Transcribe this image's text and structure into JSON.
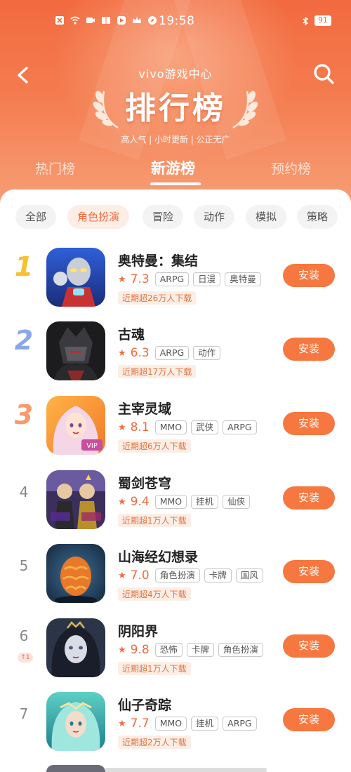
{
  "status_bar": {
    "time": "19:58",
    "battery": "91"
  },
  "header": {
    "brand": "vivo游戏中心",
    "title": "排行榜",
    "subtitle": "高人气 | 小时更新 | 公正无广"
  },
  "tabs": [
    {
      "label": "热门榜",
      "active": false
    },
    {
      "label": "新游榜",
      "active": true
    },
    {
      "label": "预约榜",
      "active": false
    }
  ],
  "filters": [
    {
      "label": "全部",
      "active": false
    },
    {
      "label": "角色扮演",
      "active": true
    },
    {
      "label": "冒险",
      "active": false
    },
    {
      "label": "动作",
      "active": false
    },
    {
      "label": "模拟",
      "active": false
    },
    {
      "label": "策略",
      "active": false
    }
  ],
  "install_label": "安装",
  "games": [
    {
      "rank": "1",
      "name": "奥特曼：集结",
      "score": "7.3",
      "tags": [
        "ARPG",
        "日漫",
        "奥特曼"
      ],
      "downloads": "近期超26万人下载",
      "icon": "ultraman-icon"
    },
    {
      "rank": "2",
      "name": "古魂",
      "score": "6.3",
      "tags": [
        "ARPG",
        "动作"
      ],
      "downloads": "近期超17万人下载",
      "icon": "dark-knight-icon"
    },
    {
      "rank": "3",
      "name": "主宰灵域",
      "score": "8.1",
      "tags": [
        "MMO",
        "武侠",
        "ARPG"
      ],
      "downloads": "近期超6万人下载",
      "icon": "fairy-girl-icon"
    },
    {
      "rank": "4",
      "name": "蜀剑苍穹",
      "score": "9.4",
      "tags": [
        "MMO",
        "挂机",
        "仙侠"
      ],
      "downloads": "近期超1万人下载",
      "icon": "warriors-icon"
    },
    {
      "rank": "5",
      "name": "山海经幻想录",
      "score": "7.0",
      "tags": [
        "角色扮演",
        "卡牌",
        "国风"
      ],
      "downloads": "近期超4万人下载",
      "icon": "dragon-egg-icon"
    },
    {
      "rank": "6",
      "rank_change": "↑1",
      "name": "阴阳界",
      "score": "9.8",
      "tags": [
        "恐怖",
        "卡牌",
        "角色扮演"
      ],
      "downloads": "近期超1万人下载",
      "icon": "ghost-girl-icon"
    },
    {
      "rank": "7",
      "name": "仙子奇踪",
      "score": "7.7",
      "tags": [
        "MMO",
        "挂机",
        "ARPG"
      ],
      "downloads": "近期超2万人下载",
      "icon": "elf-girl-icon"
    }
  ]
}
